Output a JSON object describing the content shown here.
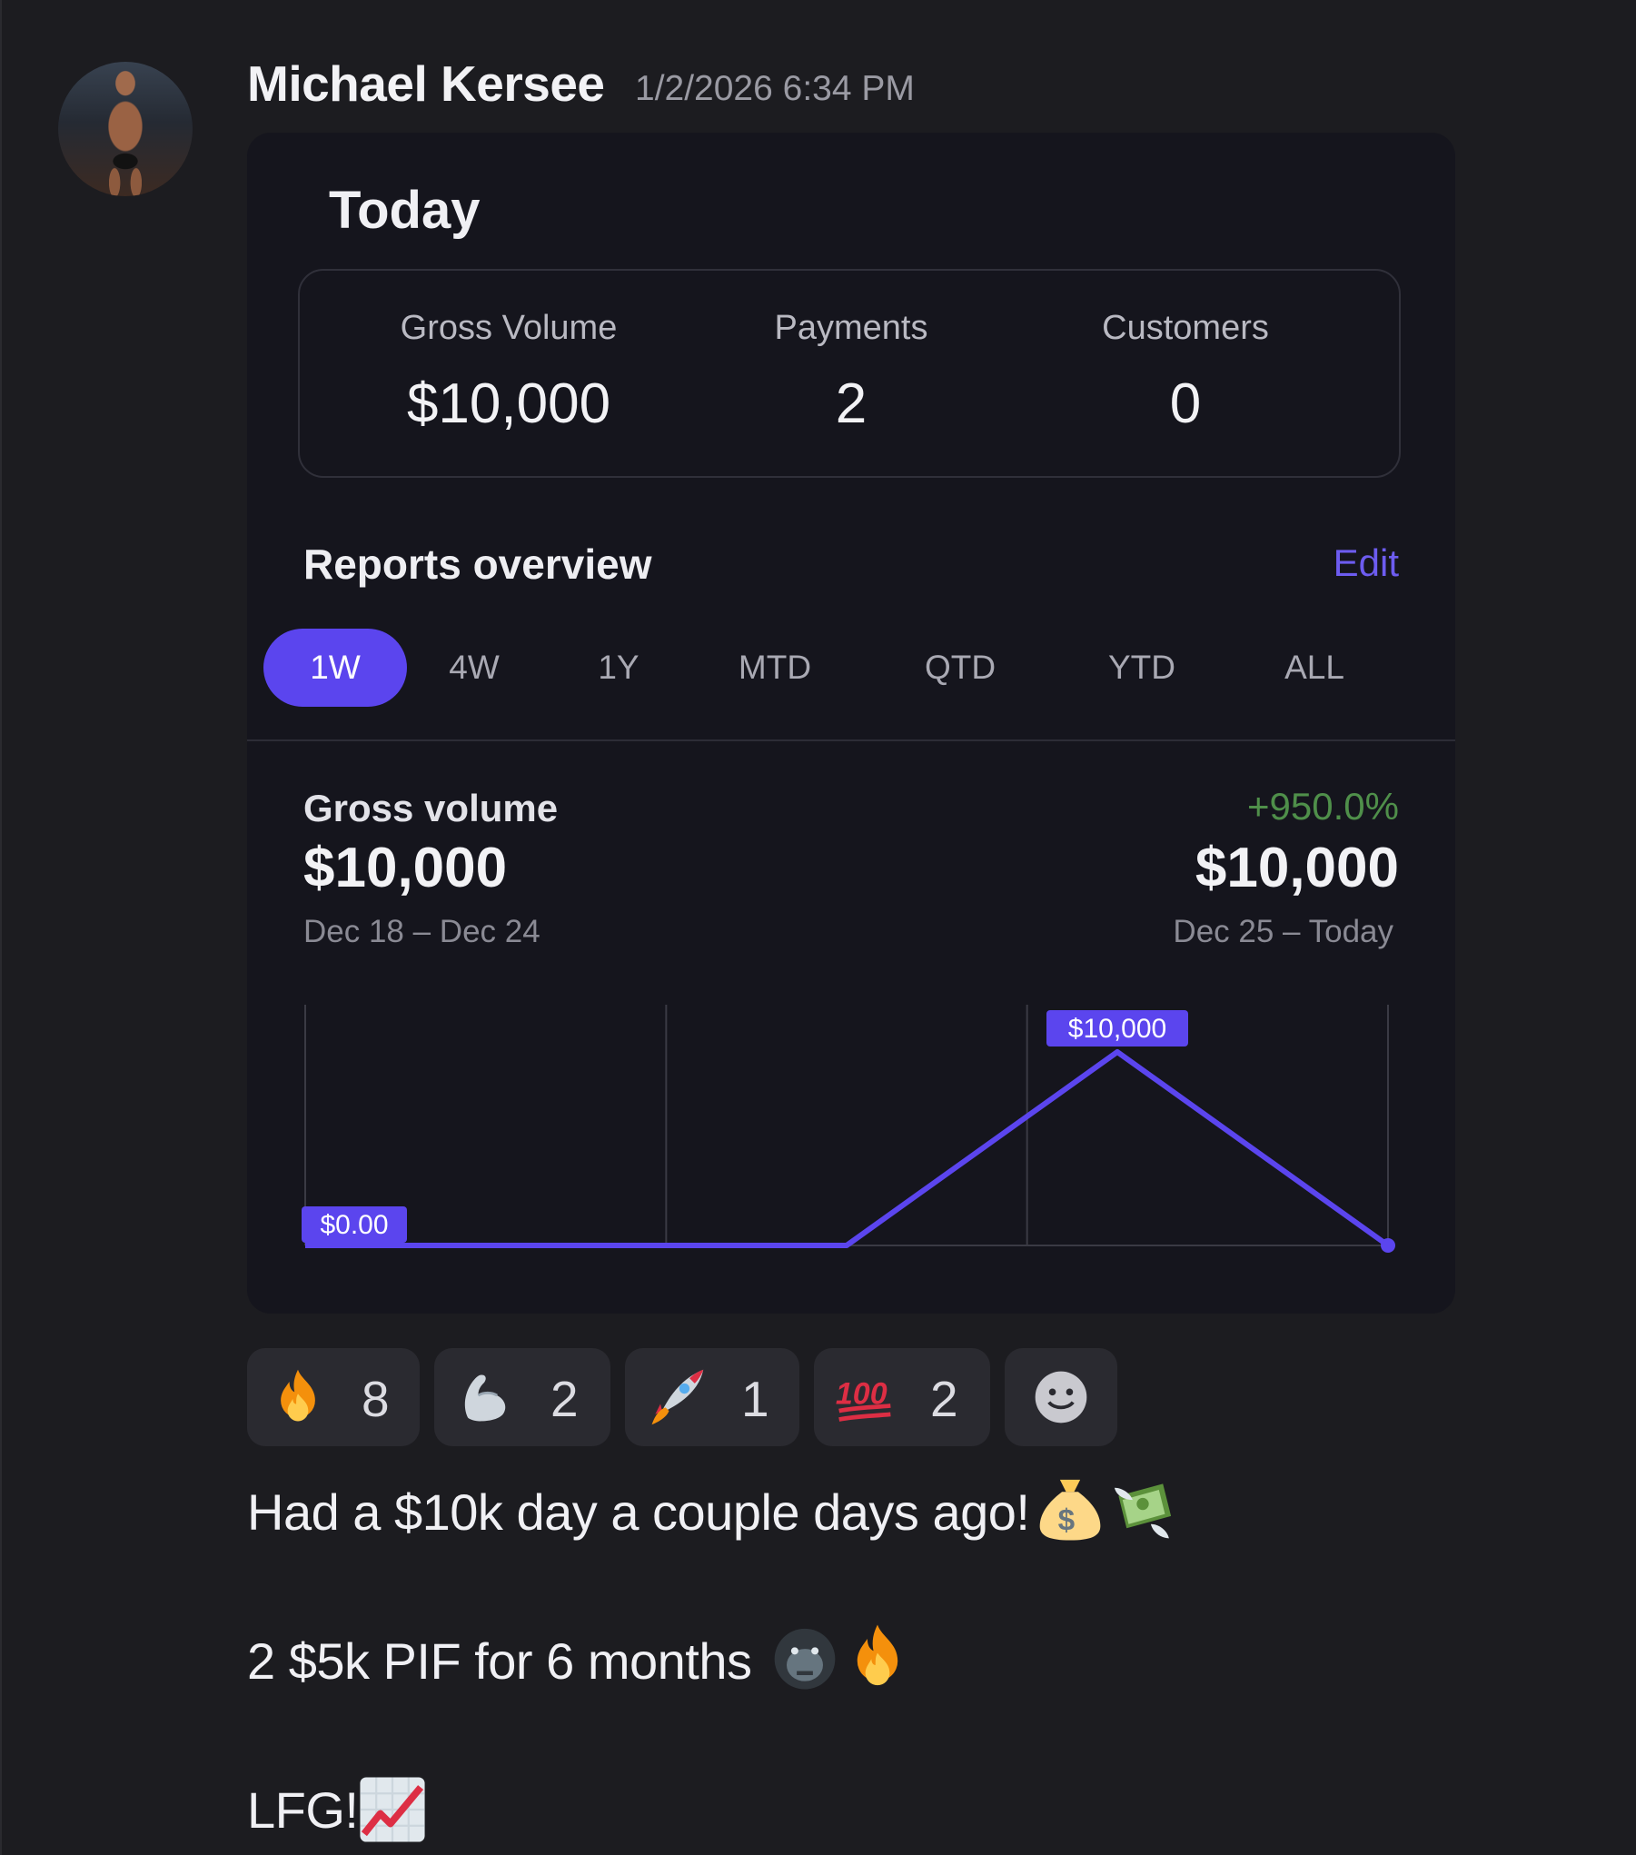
{
  "message": {
    "author": "Michael Kersee",
    "timestamp": "1/2/2026 6:34 PM",
    "lines": [
      "Had a $10k day a couple days ago!",
      "2 $5k PIF for 6 months",
      "LFG!"
    ],
    "inline_emoji": [
      [
        "money-bag",
        "money-with-wings"
      ],
      [
        "gorilla",
        "fire"
      ],
      [
        "chart-increasing"
      ]
    ]
  },
  "card": {
    "title": "Today",
    "stats": [
      {
        "label": "Gross Volume",
        "value": "$10,000"
      },
      {
        "label": "Payments",
        "value": "2"
      },
      {
        "label": "Customers",
        "value": "0"
      }
    ],
    "reports_title": "Reports overview",
    "edit_label": "Edit",
    "tabs": [
      "1W",
      "4W",
      "1Y",
      "MTD",
      "QTD",
      "YTD",
      "ALL"
    ],
    "active_tab": "1W",
    "gross_volume": {
      "label": "Gross volume",
      "previous_value": "$10,000",
      "previous_range": "Dec 18 – Dec 24",
      "change": "+950.0%",
      "current_value": "$10,000",
      "current_range": "Dec 25 – Today"
    },
    "accent_color": "#5b45ee",
    "positive_color": "#4f8f4a"
  },
  "chart_data": {
    "type": "line",
    "x": [
      0,
      1,
      2,
      3,
      4
    ],
    "values": [
      0,
      0,
      0,
      10000,
      0
    ],
    "gridlines": 4,
    "labels": [
      {
        "point_index": 0,
        "text": "$0.00"
      },
      {
        "point_index": 3,
        "text": "$10,000"
      }
    ],
    "ylim": [
      0,
      10000
    ]
  },
  "reactions": [
    {
      "emoji": "fire",
      "count": "8"
    },
    {
      "emoji": "flexed-biceps",
      "count": "2"
    },
    {
      "emoji": "rocket",
      "count": "1"
    },
    {
      "emoji": "hundred-points",
      "count": "2"
    },
    {
      "emoji": "add-reaction",
      "count": ""
    }
  ]
}
